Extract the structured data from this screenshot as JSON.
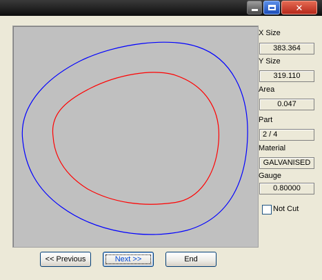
{
  "window": {
    "title_buttons": [
      "minimize",
      "maximize",
      "close"
    ],
    "close_glyph": "✕"
  },
  "fields": {
    "x_size": {
      "label": "X Size",
      "value": "383.364"
    },
    "y_size": {
      "label": "Y Size",
      "value": "319.110"
    },
    "area": {
      "label": "Area",
      "value": "0.047"
    },
    "part": {
      "label": "Part",
      "value": "2 / 4"
    },
    "material": {
      "label": "Material",
      "value": "GALVANISED"
    },
    "gauge": {
      "label": "Gauge",
      "value": "0.80000"
    }
  },
  "not_cut": {
    "label": "Not Cut",
    "checked": false
  },
  "buttons": {
    "previous": "<< Previous",
    "next": "Next >>",
    "end": "End"
  },
  "preview": {
    "background": "#c0c0c0",
    "outer_color": "#0000ff",
    "inner_color": "#ff0000"
  }
}
